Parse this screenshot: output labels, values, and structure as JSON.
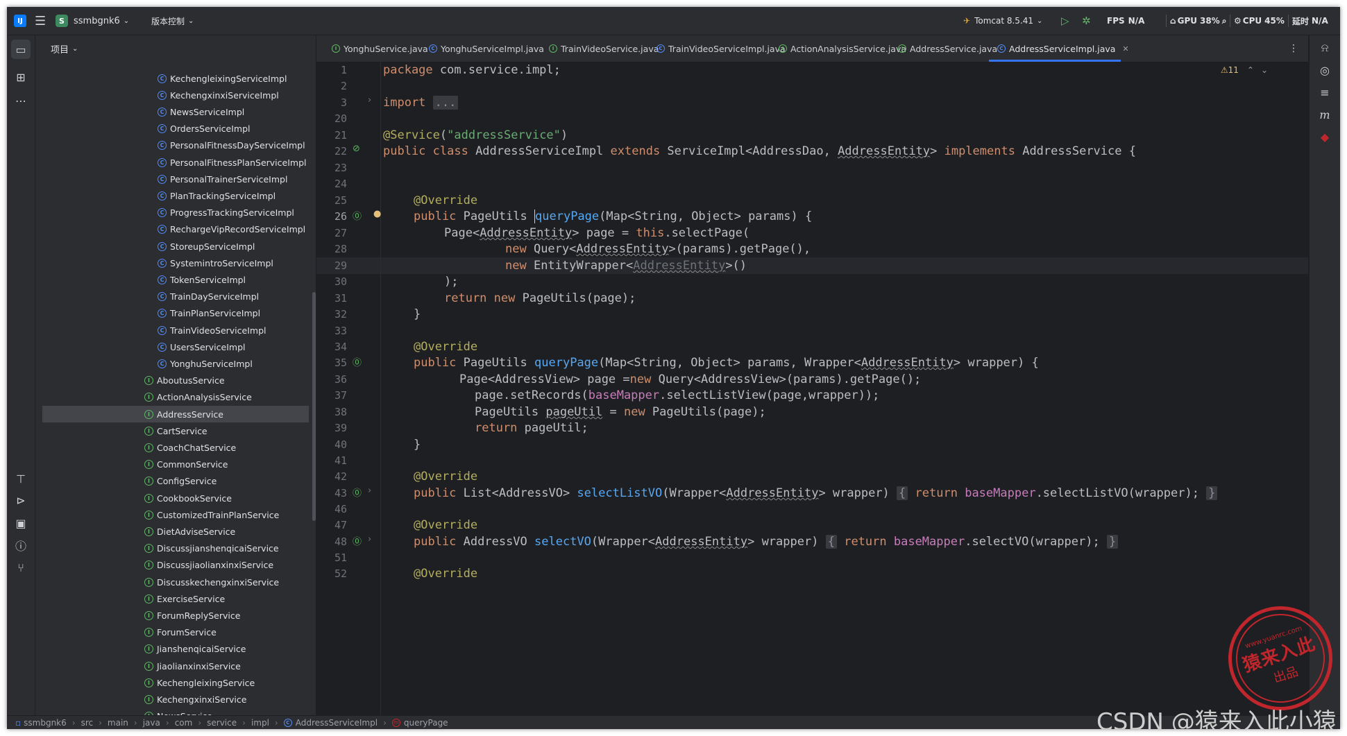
{
  "titlebar": {
    "project": "ssmbgnk6",
    "project_badge": "S",
    "vcs": "版本控制",
    "run_config": "Tomcat 8.5.41",
    "fps_label": "FPS",
    "fps_value": "N/A",
    "gpu_label": "GPU",
    "gpu_value": "38%",
    "cpu_label": "CPU",
    "cpu_value": "45%",
    "time_label": "延时",
    "time_value": "N/A"
  },
  "project_panel": {
    "title": "项目",
    "impl_items": [
      "KechengleixingServiceImpl",
      "KechengxinxiServiceImpl",
      "NewsServiceImpl",
      "OrdersServiceImpl",
      "PersonalFitnessDayServiceImpl",
      "PersonalFitnessPlanServiceImpl",
      "PersonalTrainerServiceImpl",
      "PlanTrackingServiceImpl",
      "ProgressTrackingServiceImpl",
      "RechargeVipRecordServiceImpl",
      "StoreupServiceImpl",
      "SystemintroServiceImpl",
      "TokenServiceImpl",
      "TrainDayServiceImpl",
      "TrainPlanServiceImpl",
      "TrainVideoServiceImpl",
      "UsersServiceImpl",
      "YonghuServiceImpl"
    ],
    "service_items": [
      "AboutusService",
      "ActionAnalysisService",
      "AddressService",
      "CartService",
      "CoachChatService",
      "CommonService",
      "ConfigService",
      "CookbookService",
      "CustomizedTrainPlanService",
      "DietAdviseService",
      "DiscussjianshenqicaiService",
      "DiscussjiaolianxinxiService",
      "DiscusskechengxinxiService",
      "ExerciseService",
      "ForumReplyService",
      "ForumService",
      "JianshenqicaiService",
      "JiaolianxinxiService",
      "KechengleixingService",
      "KechengxinxiService",
      "NewsService"
    ],
    "selected": "AddressService"
  },
  "tabs": [
    {
      "label": "YonghuService.java",
      "kind": "interface"
    },
    {
      "label": "YonghuServiceImpl.java",
      "kind": "class"
    },
    {
      "label": "TrainVideoService.java",
      "kind": "interface"
    },
    {
      "label": "TrainVideoServiceImpl.java",
      "kind": "class"
    },
    {
      "label": "ActionAnalysisService.java",
      "kind": "interface"
    },
    {
      "label": "AddressService.java",
      "kind": "interface"
    },
    {
      "label": "AddressServiceImpl.java",
      "kind": "class",
      "active": true
    }
  ],
  "editor": {
    "warnings": "⚠11",
    "current_line": "26",
    "line_numbers": [
      "1",
      "2",
      "3",
      "20",
      "21",
      "22",
      "23",
      "24",
      "25",
      "26",
      "27",
      "28",
      "29",
      "30",
      "31",
      "32",
      "33",
      "34",
      "35",
      "36",
      "37",
      "38",
      "39",
      "40",
      "41",
      "42",
      "43",
      "46",
      "47",
      "48",
      "51",
      "52"
    ]
  },
  "code": {
    "l1a": "package",
    "l1b": " com.service.impl;",
    "l3a": "import",
    "l3b": "...",
    "l21a": "@Service",
    "l21b": "(",
    "l21c": "\"addressService\"",
    "l21d": ")",
    "l22a": "public class",
    "l22b": " AddressServiceImpl ",
    "l22c": "extends",
    "l22d": " ServiceImpl<AddressDao, ",
    "l22e": "AddressEntity",
    "l22f": "> ",
    "l22g": "implements",
    "l22h": " AddressService {",
    "l25": "@Override",
    "l26a": "public",
    "l26b": " PageUtils ",
    "l26c": "queryPage",
    "l26d": "(Map<String, Object> params) {",
    "l27a": "Page<",
    "l27b": "AddressEntity",
    "l27c": "> page = ",
    "l27d": "this",
    "l27e": ".selectPage(",
    "l28a": "new",
    "l28b": " Query<",
    "l28c": "AddressEntity",
    "l28d": ">(params).getPage(),",
    "l29a": "new",
    "l29b": " EntityWrapper<",
    "l29c": "AddressEntity",
    "l29d": ">()",
    "l30": ");",
    "l31a": "return new",
    "l31b": " PageUtils(page);",
    "l32": "}",
    "l34": "@Override",
    "l35a": "public",
    "l35b": " PageUtils ",
    "l35c": "queryPage",
    "l35d": "(Map<String, Object> params, Wrapper<",
    "l35e": "AddressEntity",
    "l35f": "> wrapper) {",
    "l36a": "Page<AddressView> page =",
    "l36b": "new",
    "l36c": " Query<AddressView>(params).getPage();",
    "l37a": "page.setRecords(",
    "l37b": "baseMapper",
    "l37c": ".selectListView(page,wrapper));",
    "l38a": "PageUtils ",
    "l38b": "pageUtil",
    "l38c": " = ",
    "l38d": "new",
    "l38e": " PageUtils(page);",
    "l39a": "return",
    "l39b": " pageUtil;",
    "l40": "}",
    "l42": "@Override",
    "l43a": "public",
    "l43b": " List<AddressVO> ",
    "l43c": "selectListVO",
    "l43d": "(Wrapper<",
    "l43e": "AddressEntity",
    "l43f": "> wrapper)",
    "l43g": "{",
    "l43h": "return",
    "l43i": " baseMapper",
    "l43j": ".selectListVO(wrapper);",
    "l43k": "}",
    "l47": "@Override",
    "l48a": "public",
    "l48b": " AddressVO ",
    "l48c": "selectVO",
    "l48d": "(Wrapper<",
    "l48e": "AddressEntity",
    "l48f": "> wrapper)",
    "l48g": "{",
    "l48h": "return",
    "l48i": " baseMapper",
    "l48j": ".selectVO(wrapper);",
    "l48k": "}",
    "l52": "@Override"
  },
  "statusbar": {
    "crumbs": [
      "ssmbgnk6",
      "src",
      "main",
      "java",
      "com",
      "service",
      "impl",
      "AddressServiceImpl",
      "queryPage"
    ]
  },
  "watermark": {
    "stamp_main": "猿来入此",
    "stamp_url": "www.yuanrc.com",
    "stamp_sub": "出品",
    "csdn": "CSDN @猿来入此小猿"
  },
  "colors": {
    "accent": "#3574f0",
    "background": "#1e1f22",
    "panel": "#2b2d30",
    "keyword": "#cf8e6d",
    "string": "#6aab73",
    "function": "#56a8f5",
    "annotation": "#b3ae60",
    "field": "#c77dbb"
  }
}
